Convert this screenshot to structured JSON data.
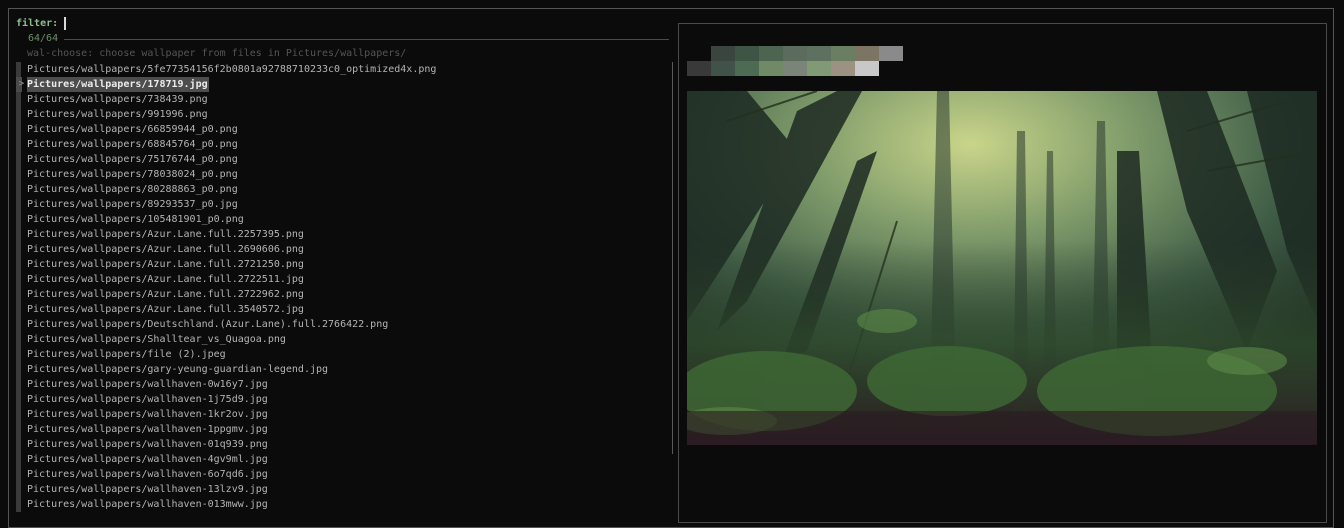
{
  "filter": {
    "label": "filter:",
    "value": ""
  },
  "counter": "64/64",
  "header": "wal-choose: choose wallpaper from files in Pictures/wallpapers/",
  "selected_index": 1,
  "pointer_glyph": ">",
  "files": [
    "Pictures/wallpapers/5fe77354156f2b0801a92788710233c0_optimized4x.png",
    "Pictures/wallpapers/178719.jpg",
    "Pictures/wallpapers/738439.png",
    "Pictures/wallpapers/991996.png",
    "Pictures/wallpapers/66859944_p0.png",
    "Pictures/wallpapers/68845764_p0.png",
    "Pictures/wallpapers/75176744_p0.png",
    "Pictures/wallpapers/78038024_p0.png",
    "Pictures/wallpapers/80288863_p0.png",
    "Pictures/wallpapers/89293537_p0.jpg",
    "Pictures/wallpapers/105481901_p0.png",
    "Pictures/wallpapers/Azur.Lane.full.2257395.png",
    "Pictures/wallpapers/Azur.Lane.full.2690606.png",
    "Pictures/wallpapers/Azur.Lane.full.2721250.png",
    "Pictures/wallpapers/Azur.Lane.full.2722511.jpg",
    "Pictures/wallpapers/Azur.Lane.full.2722962.png",
    "Pictures/wallpapers/Azur.Lane.full.3540572.jpg",
    "Pictures/wallpapers/Deutschland.(Azur.Lane).full.2766422.png",
    "Pictures/wallpapers/Shalltear_vs_Quagoa.png",
    "Pictures/wallpapers/file (2).jpeg",
    "Pictures/wallpapers/gary-yeung-guardian-legend.jpg",
    "Pictures/wallpapers/wallhaven-0w16y7.jpg",
    "Pictures/wallpapers/wallhaven-1j75d9.jpg",
    "Pictures/wallpapers/wallhaven-1kr2ov.jpg",
    "Pictures/wallpapers/wallhaven-1ppgmv.jpg",
    "Pictures/wallpapers/wallhaven-01q939.png",
    "Pictures/wallpapers/wallhaven-4gv9ml.jpg",
    "Pictures/wallpapers/wallhaven-6o7qd6.jpg",
    "Pictures/wallpapers/wallhaven-13lzv9.jpg",
    "Pictures/wallpapers/wallhaven-013mww.jpg"
  ],
  "palette": {
    "top_row": [
      "#3b4540",
      "#3e5546",
      "#4d6450",
      "#5c6c5c",
      "#5e7160",
      "#6a7e62",
      "#7c7563",
      "#8a8a8a"
    ],
    "bottom_row": [
      "#393939",
      "#415349",
      "#4d6a52",
      "#6f8a65",
      "#7a8478",
      "#7f9a74",
      "#9d9282",
      "#c8c8c8"
    ]
  },
  "preview_image": {
    "description_icon": "forest-wallpaper-image"
  }
}
